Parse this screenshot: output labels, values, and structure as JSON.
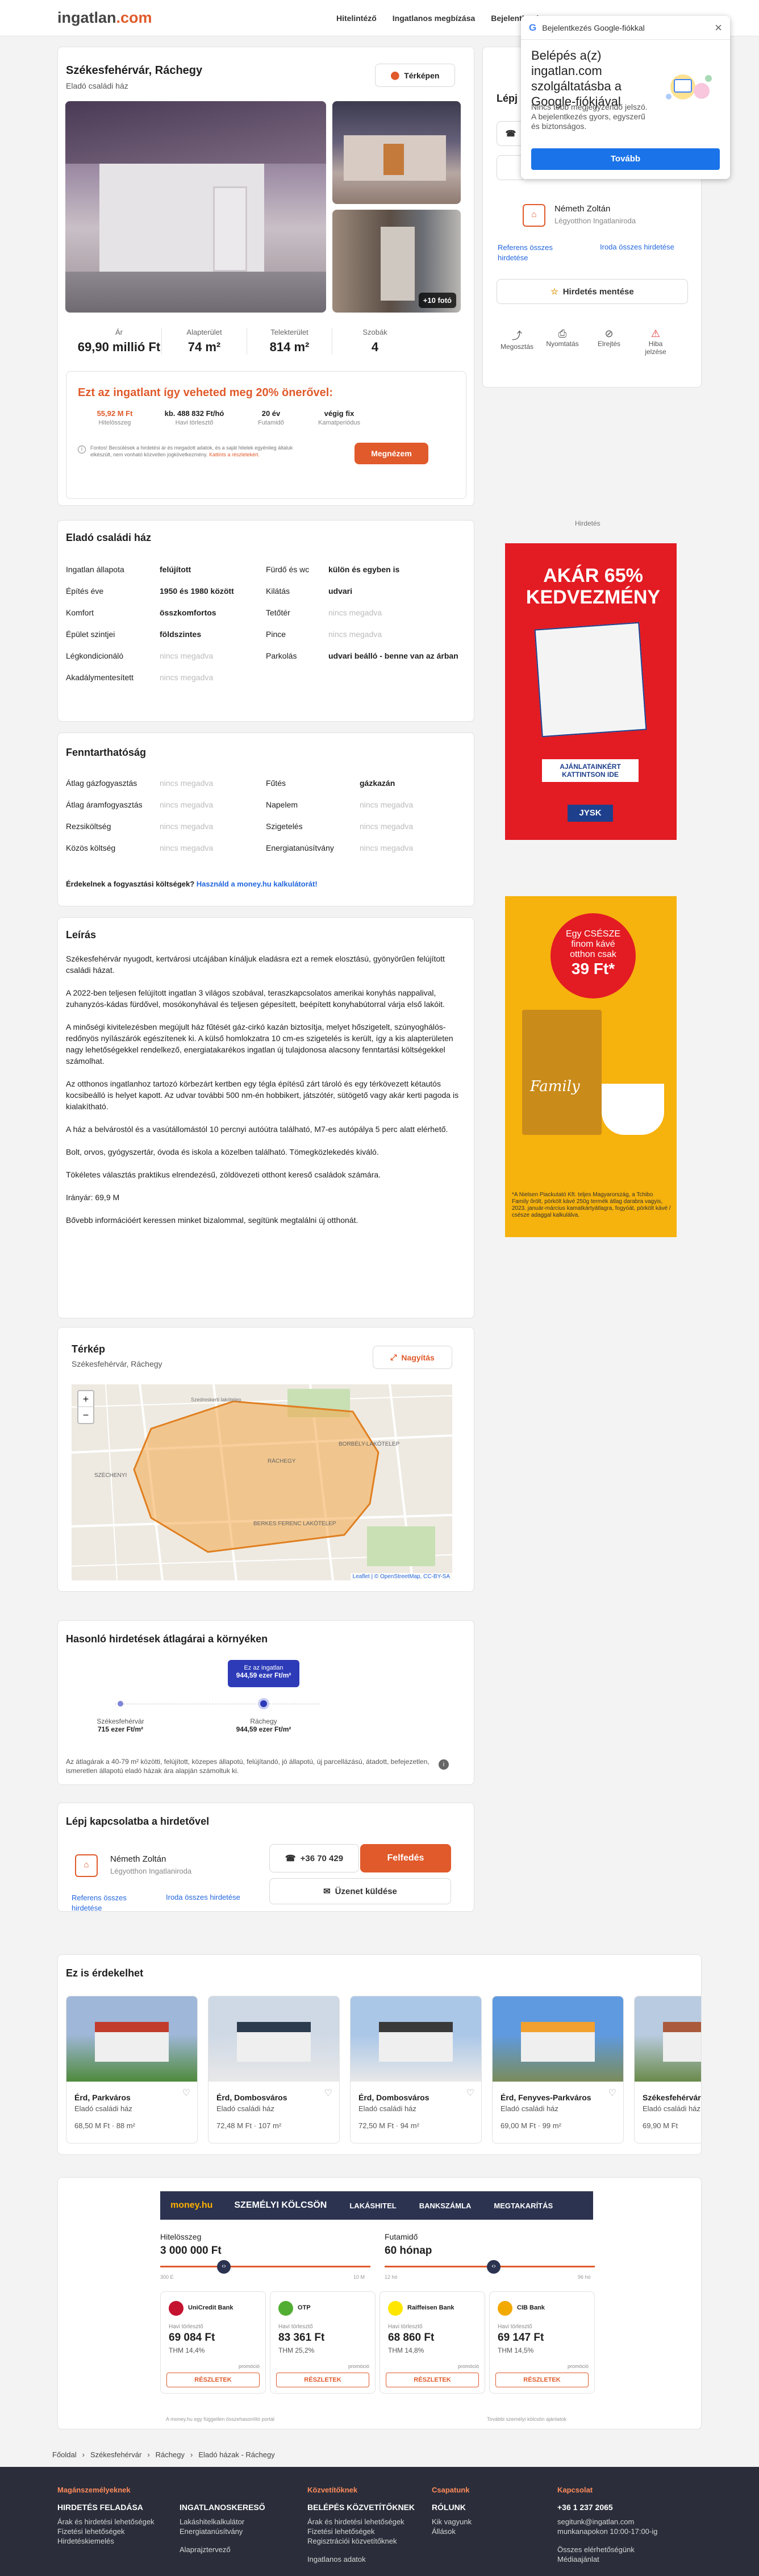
{
  "nav": {
    "logo_main": "ingatlan",
    "logo_dot": ".com",
    "items": [
      "Hitelintéző",
      "Ingatlanos megbízása",
      "Bejelentkezés"
    ]
  },
  "google": {
    "header": "Bejelentkezés Google-fiókkal",
    "title": "Belépés a(z) ingatlan.com szolgáltatásba a Google-fiókjával",
    "desc": "Nincs több megjegyzendő jelszó. A bejelentkezés gyors, egyszerű és biztonságos.",
    "button": "Tovább"
  },
  "listing": {
    "title": "Székesfehérvár, Ráchegy",
    "subtitle": "Eladó családi ház",
    "map_btn": "Térképen",
    "more_photos": "+10 fotó",
    "stats": [
      {
        "label": "Ár",
        "value": "69,90 millió Ft"
      },
      {
        "label": "Alapterület",
        "value": "74 m²"
      },
      {
        "label": "Telekterület",
        "value": "814 m²"
      },
      {
        "label": "Szobák",
        "value": "4"
      }
    ],
    "loan_title": "Ezt az ingatlant így veheted meg 20% önerővel:",
    "loan": [
      {
        "v": "55,92 M Ft",
        "l": "Hitelösszeg"
      },
      {
        "v": "kb. 488 832 Ft/hó",
        "l": "Havi törlesztő"
      },
      {
        "v": "20 év",
        "l": "Futamidő"
      },
      {
        "v": "végig fix",
        "l": "Kamatperiódus"
      }
    ],
    "loan_note": "Fontos! Becsülések a hirdetési ár és megadott adatok, és a saját hitelek egyénileg általuk elkészült, nem vonható közvetlen jogkövetkezmény.",
    "loan_link": "Kattints a részletekért.",
    "loan_btn": "Megnézem"
  },
  "side": {
    "title": "Lépj kapcsolatba a hirdetővel",
    "agent": "Németh Zoltán",
    "agency": "Légyotthon Ingatlaniroda",
    "links": [
      "Referens összes hirdetése",
      "Iroda összes hirdetése"
    ],
    "save_btn": "Hirdetés mentése",
    "actions": [
      "Megosztás",
      "Nyomtatás",
      "Elrejtés",
      "Hiba jelzése"
    ],
    "ad_label": "Hirdetés"
  },
  "ads": {
    "jysk_title": "AKÁR 65% KEDVEZMÉNY",
    "jysk_cta": "AJÁNLATAINKÉRT KATTINTSON IDE",
    "jysk_brand": "JYSK",
    "tchibo_line1": "Egy CSÉSZE",
    "tchibo_line2": "finom kávé",
    "tchibo_line3": "otthon csak",
    "tchibo_price": "39 Ft*",
    "tchibo_brand": "Family",
    "tchibo_foot": "*A Nielsen Piackutató Kft. teljes Magyarország, a Tchibo Family őrölt, pörkölt kávé 250g termék átlag darabra vagyis, 2023. január-március kamatkártyátlagra, fogyóát, pörkölt kávé / csésze adaggal kalkulálva."
  },
  "details": {
    "title": "Eladó családi ház",
    "left": [
      {
        "k": "Ingatlan állapota",
        "v": "felújított",
        "m": false
      },
      {
        "k": "Építés éve",
        "v": "1950 és 1980 között",
        "m": false
      },
      {
        "k": "Komfort",
        "v": "összkomfortos",
        "m": false
      },
      {
        "k": "Épület szintjei",
        "v": "földszintes",
        "m": false
      },
      {
        "k": "Légkondicionáló",
        "v": "nincs megadva",
        "m": true
      },
      {
        "k": "Akadálymentesített",
        "v": "nincs megadva",
        "m": true
      }
    ],
    "right": [
      {
        "k": "Fürdő és wc",
        "v": "külön és egyben is",
        "m": false
      },
      {
        "k": "Kilátás",
        "v": "udvari",
        "m": false
      },
      {
        "k": "Tetőtér",
        "v": "nincs megadva",
        "m": true
      },
      {
        "k": "Pince",
        "v": "nincs megadva",
        "m": true
      },
      {
        "k": "Parkolás",
        "v": "udvari beálló - benne van az árban",
        "m": false
      }
    ]
  },
  "sustain": {
    "title": "Fenntarthatóság",
    "left": [
      {
        "k": "Átlag gázfogyasztás",
        "v": "nincs megadva",
        "m": true
      },
      {
        "k": "Átlag áramfogyasztás",
        "v": "nincs megadva",
        "m": true
      },
      {
        "k": "Rezsiköltség",
        "v": "nincs megadva",
        "m": true
      },
      {
        "k": "Közös költség",
        "v": "nincs megadva",
        "m": true
      }
    ],
    "right": [
      {
        "k": "Fűtés",
        "v": "gázkazán",
        "m": false
      },
      {
        "k": "Napelem",
        "v": "nincs megadva",
        "m": true
      },
      {
        "k": "Szigetelés",
        "v": "nincs megadva",
        "m": true
      },
      {
        "k": "Energiatanúsítvány",
        "v": "nincs megadva",
        "m": true
      }
    ],
    "q": "Érdekelnek a fogyasztási költségek?",
    "link": "Használd a money.hu kalkulátorát!"
  },
  "desc": {
    "title": "Leírás",
    "p": [
      "Székesfehérvár nyugodt, kertvárosi utcájában kínáljuk eladásra ezt a remek elosztású, gyönyörűen felújított családi házat.",
      "A 2022-ben teljesen felújított ingatlan 3 világos szobával, teraszkapcsolatos amerikai konyhás nappalival, zuhanyzós-kádas fürdővel, mosókonyhával és teljesen gépesített, beépített konyhabútorral várja első lakóit.",
      "A minőségi kivitelezésben megújult ház fűtését gáz-cirkó kazán biztosítja, melyet hőszigetelt, szúnyoghálós-redőnyös nyílászárók egészítenek ki. A külső homlokzatra 10 cm-es szigetelés is került, így a kis alapterületen nagy lehetőségekkel rendelkező, energiatakarékos ingatlan új tulajdonosa alacsony fenntartási költségekkel számolhat.",
      "Az otthonos ingatlanhoz tartozó körbezárt kertben egy tégla építésű zárt tároló és egy térkövezett kétautós kocsibeálló is helyet kapott. Az udvar további 500 nm-én hobbikert, játszótér, sütögető vagy akár kerti pagoda is kialakítható.",
      "A ház a belvárostól és a vasútállomástól 10 percnyi autóútra található, M7-es autópálya 5 perc alatt elérhető.",
      "Bolt, orvos, gyógyszertár, óvoda és iskola a közelben található. Tömegközlekedés kiváló.",
      "Tökéletes választás praktikus elrendezésű, zöldövezeti otthont kereső családok számára.",
      "Irányár: 69,9 M",
      "Bővebb információért keressen minket bizalommal, segítünk megtalálni új otthonát."
    ]
  },
  "map": {
    "title": "Térkép",
    "subtitle": "Székesfehérvár, Ráchegy",
    "enlarge": "Nagyítás",
    "labels": [
      "Szedreskerti lakótelep",
      "RÁCHEGY",
      "BORBÉLY-LAKÓTELEP",
      "BERKES FERENC LAKÓTELEP",
      "SZÉCHENYI"
    ],
    "attrib": "Leaflet | © OpenStreetMap, CC-BY-SA",
    "zoom_in": "+",
    "zoom_out": "−"
  },
  "similar": {
    "title": "Hasonló hirdetések átlagárai a környéken",
    "bubble_l1": "Ez az ingatlan",
    "bubble_l2": "944,59 ezer Ft/m²",
    "points": [
      {
        "name": "Székesfehérvár",
        "value": "715 ezer Ft/m²"
      },
      {
        "name": "Ráchegy",
        "value": "944,59 ezer Ft/m²"
      }
    ],
    "note": "Az átlagárak a 40-79 m² közötti, felújított, közepes állapotú, felújítandó, jó állapotú, új parcellázású, átadott, befejezetlen, ismeretlen állapotú eladó házak ára alapján számoltuk ki."
  },
  "contact": {
    "title": "Lépj kapcsolatba a hirdetővel",
    "phone": "+36 70 429",
    "reveal": "Felfedés",
    "message": "Üzenet küldése"
  },
  "cards": {
    "title": "Ez is érdekelhet",
    "items": [
      {
        "loc": "Érd, Parkváros",
        "type": "Eladó családi ház",
        "price": "68,50 M Ft",
        "area": "88 m²"
      },
      {
        "loc": "Érd, Dombosváros",
        "type": "Eladó családi ház",
        "price": "72,48 M Ft",
        "area": "107 m²"
      },
      {
        "loc": "Érd, Dombosváros",
        "type": "Eladó családi ház",
        "price": "72,50 M Ft",
        "area": "94 m²"
      },
      {
        "loc": "Érd, Fenyves-Parkváros",
        "type": "Eladó családi ház",
        "price": "69,00 M Ft",
        "area": "99 m²"
      },
      {
        "loc": "Székesfehérvár",
        "type": "Eladó családi ház",
        "price": "69,90 M Ft",
        "area": ""
      }
    ]
  },
  "money": {
    "brand": "money.hu",
    "tabs": [
      "SZEMÉLYI KÖLCSÖN",
      "LAKÁSHITEL",
      "BANKSZÁMLA",
      "MEGTAKARÍTÁS"
    ],
    "amount_label": "Hitelösszeg",
    "amount": "3 000 000 Ft",
    "term_label": "Futamidő",
    "term": "60 hónap",
    "min1": "300 E",
    "max1": "10 M",
    "min2": "12 hó",
    "max2": "96 hó",
    "banks": [
      {
        "name": "UniCredit Bank",
        "amount": "69 084 Ft",
        "thm": "THM 14,4%"
      },
      {
        "name": "OTP",
        "amount": "83 361 Ft",
        "thm": "THM 25,2%"
      },
      {
        "name": "Raiffeisen Bank",
        "amount": "68 860 Ft",
        "thm": "THM 14,8%"
      },
      {
        "name": "CIB Bank",
        "amount": "69 147 Ft",
        "thm": "THM 14,5%"
      }
    ],
    "monthly": "Havi törlesztő",
    "details": "RÉSZLETEK",
    "promo": "promóció",
    "foot_left": "A money.hu egy független összehasonlító portál",
    "foot_right": "További személyi kölcsön ajánlatok"
  },
  "breadcrumb": [
    "Főoldal",
    "Székesfehérvár",
    "Ráchegy",
    "Eladó házak - Ráchegy"
  ],
  "footer": {
    "cols": [
      {
        "h": "Magánszemélyeknek",
        "s": "HIRDETÉS FELADÁSA",
        "items": [
          "Árak és hirdetési lehetőségek",
          "Fizetési lehetőségek",
          "Hirdetéskiemelés"
        ]
      },
      {
        "h": "",
        "s": "INGATLANOSKERESŐ",
        "items": [
          "Lakáshitelkalkulátor",
          "Energiatanúsítvány",
          "",
          "Alaprajztervező"
        ]
      },
      {
        "h": "Közvetítőknek",
        "s": "BELÉPÉS KÖZVETÍTŐKNEK",
        "items": [
          "Árak és hirdetési lehetőségek",
          "Fizetési lehetőségek",
          "Regisztrációi közvetítőknek",
          "",
          "Ingatlanos adatok"
        ]
      },
      {
        "h": "Csapatunk",
        "s": "RÓLUNK",
        "items": [
          "Kik vagyunk",
          "Állások"
        ]
      },
      {
        "h": "Kapcsolat",
        "s": "+36 1 237 2065",
        "items": [
          "segitunk@ingatlan.com",
          "munkanapokon 10:00-17:00-ig",
          "",
          "Összes elérhetőségünk",
          "Médiaajánlat"
        ]
      }
    ]
  }
}
